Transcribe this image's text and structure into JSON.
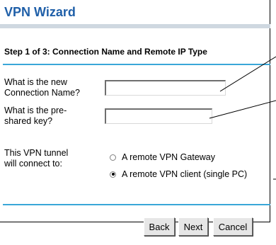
{
  "wizard": {
    "title": "VPN Wizard",
    "step_heading": "Step 1 of 3: Connection Name and Remote IP Type"
  },
  "form": {
    "connection_name_label_line1": "What is the new",
    "connection_name_label_line2": "Connection Name?",
    "connection_name_value": "",
    "preshared_key_label_line1": "What is the pre-",
    "preshared_key_label_line2": "shared key?",
    "preshared_key_value": "",
    "tunnel_label_line1": "This VPN tunnel",
    "tunnel_label_line2": "will connect to:",
    "options": [
      {
        "label": "A remote VPN Gateway",
        "selected": false
      },
      {
        "label": "A remote VPN client (single PC)",
        "selected": true
      }
    ]
  },
  "buttons": {
    "back": "Back",
    "next": "Next",
    "cancel": "Cancel"
  },
  "colors": {
    "title": "#1f5fa8",
    "rule": "#3aa7d8"
  }
}
